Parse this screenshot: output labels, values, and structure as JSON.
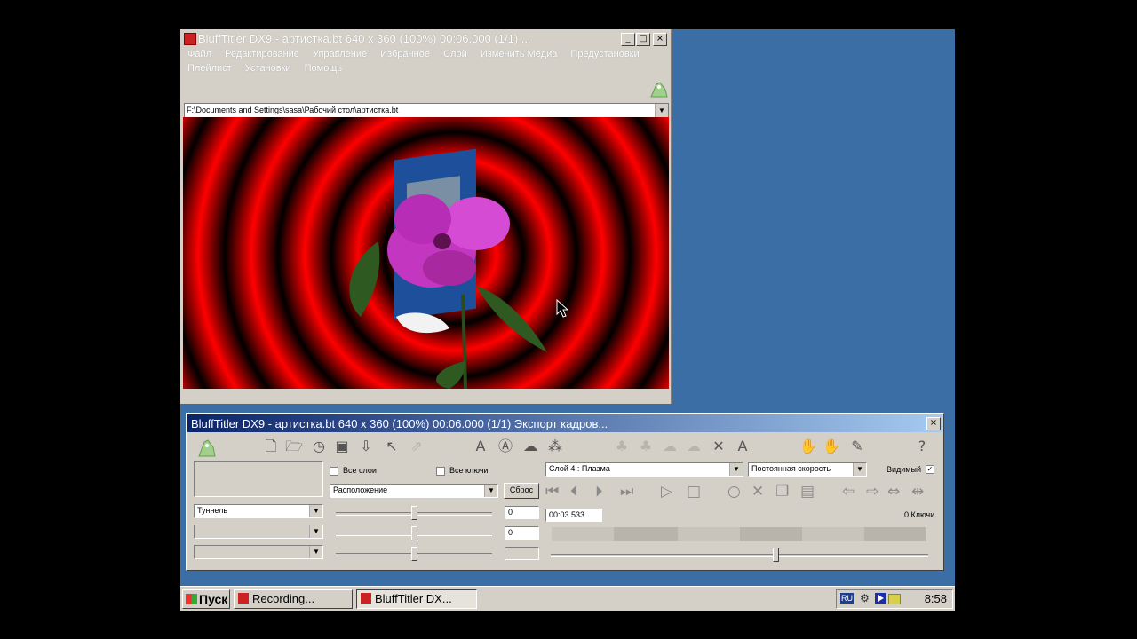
{
  "top_window": {
    "title": "BluffTitler DX9 - артистка.bt 640 x 360 (100%) 00:06.000 (1/1) ...",
    "menu_row1": [
      "Файл",
      "Редактирование",
      "Управление",
      "Избранное",
      "Слой",
      "Изменить Медиа",
      "Предустановки"
    ],
    "menu_row2": [
      "Плейлист",
      "Установки",
      "Помощь"
    ],
    "path": "F:\\Documents and Settings\\sasa\\Рабочий стол\\артистка.bt"
  },
  "bottom_window": {
    "title": "BluffTitler DX9 - артистка.bt 640 x 360 (100%) 00:06.000 (1/1) Экспорт кадров...",
    "all_layers_label": "Все слои",
    "all_keys_label": "Все ключи",
    "property_select": "Расположение",
    "reset_button": "Сброс",
    "effect_select": "Туннель",
    "value1": "0",
    "value2": "0",
    "layer_select": "Слой 4 : Плазма",
    "speed_select": "Постоянная скорость",
    "visible_label": "Видимый",
    "time_field": "00:03.533",
    "keys_count": "0 Ключи"
  },
  "taskbar": {
    "start": "Пуск",
    "tasks": [
      "Recording...",
      "BluffTitler DX..."
    ],
    "tray_lang": "RU",
    "time": "8:58"
  },
  "colors": {
    "desktop": "#3a6ea5",
    "active_title_start": "#0a246a",
    "active_title_end": "#a6caf0",
    "window_face": "#d4d0c8"
  }
}
